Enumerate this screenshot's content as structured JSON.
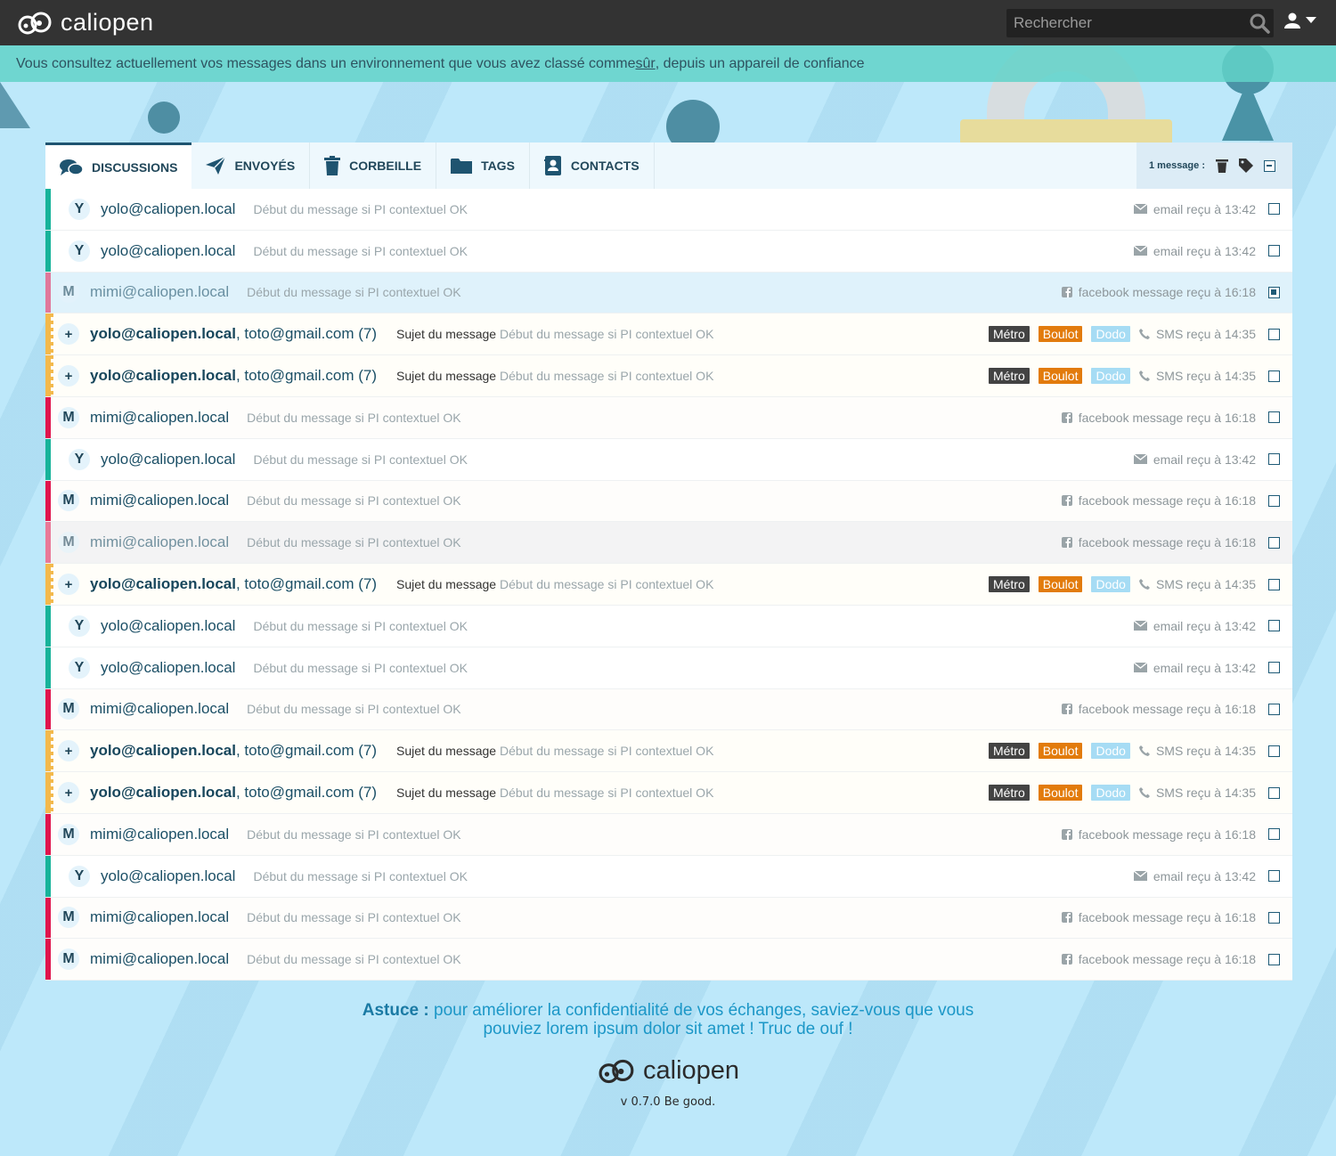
{
  "app": {
    "name": "caliopen",
    "version": "v 0.7.0 Be good."
  },
  "search": {
    "placeholder": "Rechercher"
  },
  "banner": {
    "before": "Vous consultez actuellement vos messages dans un environnement que vous avez classé comme ",
    "link": "sûr",
    "after": ", depuis un appareil de confiance"
  },
  "tabs": [
    {
      "label": "DISCUSSIONS",
      "icon": "chat-icon"
    },
    {
      "label": "ENVOYÉS",
      "icon": "send-icon"
    },
    {
      "label": "CORBEILLE",
      "icon": "trash-icon"
    },
    {
      "label": "TAGS",
      "icon": "folder-icon"
    },
    {
      "label": "CONTACTS",
      "icon": "contact-book-icon"
    }
  ],
  "selection": {
    "label": "1 message :"
  },
  "tags": {
    "metro": "Métro",
    "boulot": "Boulot",
    "dodo": "Dodo"
  },
  "rows": [
    {
      "type": "email",
      "initial": "Y",
      "sender": "yolo@caliopen.local",
      "snippet": "Début du message si PI contextuel OK",
      "meta": "email reçu à 13:42",
      "checked": false
    },
    {
      "type": "email",
      "initial": "Y",
      "sender": "yolo@caliopen.local",
      "snippet": "Début du message si PI contextuel OK",
      "meta": "email reçu à 13:42",
      "checked": false
    },
    {
      "type": "fb",
      "state": "highlight",
      "initial": "M",
      "sender": "mimi@caliopen.local",
      "snippet": "Début du message si PI contextuel OK",
      "meta": "facebook message reçu à 16:18",
      "checked": true
    },
    {
      "type": "sms",
      "initial": "+",
      "sender_bold": "yolo@caliopen.local",
      "sender_rest": ", toto@gmail.com (7)",
      "subject": "Sujet du message",
      "snippet": "Début du message si PI contextuel OK",
      "meta": "SMS reçu à 14:35",
      "checked": false
    },
    {
      "type": "sms",
      "initial": "+",
      "sender_bold": "yolo@caliopen.local",
      "sender_rest": ", toto@gmail.com (7)",
      "subject": "Sujet du message",
      "snippet": "Début du message si PI contextuel OK",
      "meta": "SMS reçu à 14:35",
      "checked": false
    },
    {
      "type": "fb",
      "initial": "M",
      "sender": "mimi@caliopen.local",
      "snippet": "Début du message si PI contextuel OK",
      "meta": "facebook message reçu à 16:18",
      "checked": false
    },
    {
      "type": "email",
      "initial": "Y",
      "sender": "yolo@caliopen.local",
      "snippet": "Début du message si PI contextuel OK",
      "meta": "email reçu à 13:42",
      "checked": false
    },
    {
      "type": "fb",
      "initial": "M",
      "sender": "mimi@caliopen.local",
      "snippet": "Début du message si PI contextuel OK",
      "meta": "facebook message reçu à 16:18",
      "checked": false
    },
    {
      "type": "fb",
      "state": "faded",
      "initial": "M",
      "sender": "mimi@caliopen.local",
      "snippet": "Début du message si PI contextuel OK",
      "meta": "facebook message reçu à 16:18",
      "checked": false
    },
    {
      "type": "sms",
      "initial": "+",
      "sender_bold": "yolo@caliopen.local",
      "sender_rest": ", toto@gmail.com (7)",
      "subject": "Sujet du message",
      "snippet": "Début du message si PI contextuel OK",
      "meta": "SMS reçu à 14:35",
      "checked": false
    },
    {
      "type": "email",
      "initial": "Y",
      "sender": "yolo@caliopen.local",
      "snippet": "Début du message si PI contextuel OK",
      "meta": "email reçu à 13:42",
      "checked": false
    },
    {
      "type": "email",
      "initial": "Y",
      "sender": "yolo@caliopen.local",
      "snippet": "Début du message si PI contextuel OK",
      "meta": "email reçu à 13:42",
      "checked": false
    },
    {
      "type": "fb",
      "initial": "M",
      "sender": "mimi@caliopen.local",
      "snippet": "Début du message si PI contextuel OK",
      "meta": "facebook message reçu à 16:18",
      "checked": false
    },
    {
      "type": "sms",
      "initial": "+",
      "sender_bold": "yolo@caliopen.local",
      "sender_rest": ", toto@gmail.com (7)",
      "subject": "Sujet du message",
      "snippet": "Début du message si PI contextuel OK",
      "meta": "SMS reçu à 14:35",
      "checked": false
    },
    {
      "type": "sms",
      "initial": "+",
      "sender_bold": "yolo@caliopen.local",
      "sender_rest": ", toto@gmail.com (7)",
      "subject": "Sujet du message",
      "snippet": "Début du message si PI contextuel OK",
      "meta": "SMS reçu à 14:35",
      "checked": false
    },
    {
      "type": "fb",
      "initial": "M",
      "sender": "mimi@caliopen.local",
      "snippet": "Début du message si PI contextuel OK",
      "meta": "facebook message reçu à 16:18",
      "checked": false
    },
    {
      "type": "email",
      "initial": "Y",
      "sender": "yolo@caliopen.local",
      "snippet": "Début du message si PI contextuel OK",
      "meta": "email reçu à 13:42",
      "checked": false
    },
    {
      "type": "fb",
      "initial": "M",
      "sender": "mimi@caliopen.local",
      "snippet": "Début du message si PI contextuel OK",
      "meta": "facebook message reçu à 16:18",
      "checked": false
    },
    {
      "type": "fb",
      "initial": "M",
      "sender": "mimi@caliopen.local",
      "snippet": "Début du message si PI contextuel OK",
      "meta": "facebook message reçu à 16:18",
      "checked": false
    }
  ],
  "tip": {
    "label": "Astuce :",
    "text": " pour améliorer la confidentialité de vos échanges, saviez-vous que vous pouviez lorem ipsum dolor sit amet ! Truc de ouf !"
  },
  "colors": {
    "topbar": "#333333",
    "banner": "#62d2c8",
    "email_stripe": "#17b39a",
    "facebook_stripe": "#e0144c",
    "sms_stripe": "#f3b94c",
    "tag_metro": "#434343",
    "tag_boulot": "#e27b0c",
    "tag_dodo": "#a6dcf4"
  }
}
